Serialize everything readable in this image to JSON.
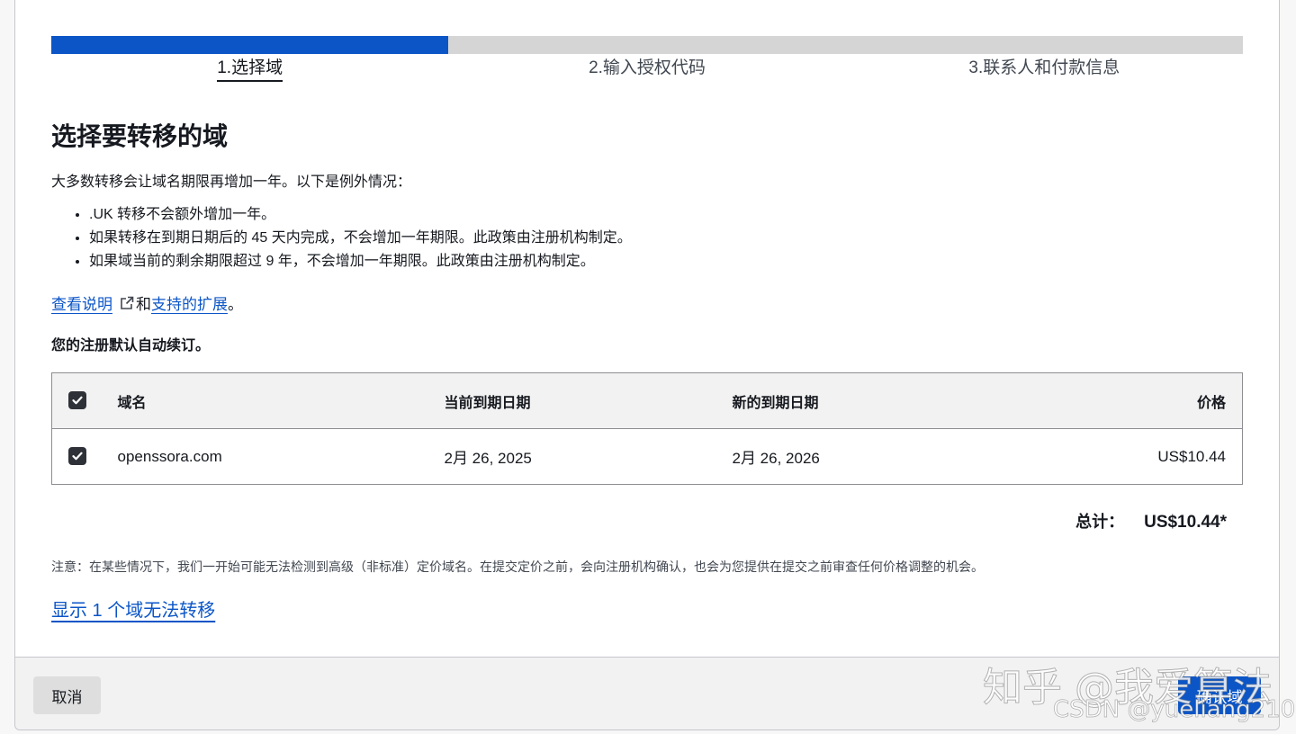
{
  "wizard": {
    "steps": [
      {
        "label": "1.选择域",
        "active": true
      },
      {
        "label": "2.输入授权代码",
        "active": false
      },
      {
        "label": "3.联系人和付款信息",
        "active": false
      }
    ],
    "progress": 0.333
  },
  "page": {
    "title": "选择要转移的域",
    "intro": "大多数转移会让域名期限再增加一年。以下是例外情况：",
    "rules": [
      ".UK 转移不会额外增加一年。",
      "如果转移在到期日期后的 45 天内完成，不会增加一年期限。此政策由注册机构制定。",
      "如果域当前的剩余期限超过 9 年，不会增加一年期限。此政策由注册机构制定。"
    ],
    "links": {
      "instructions": "查看说明",
      "and": "和",
      "supported": "支持的扩展",
      "period": "。"
    },
    "auto_renew": "您的注册默认自动续订。"
  },
  "table": {
    "headers": {
      "domain": "域名",
      "current_expiry": "当前到期日期",
      "new_expiry": "新的到期日期",
      "price": "价格"
    },
    "rows": [
      {
        "checked": true,
        "domain": "openssora.com",
        "current_expiry": "2月 26, 2025",
        "new_expiry": "2月 26, 2026",
        "price": "US$10.44"
      }
    ]
  },
  "total": {
    "label": "总计：",
    "value": "US$10.44*"
  },
  "note": "注意：在某些情况下，我们一开始可能无法检测到高级（非标准）定价域名。在提交定价之前，会向注册机构确认，也会为您提供在提交之前审查任何价格调整的机会。",
  "show_unavailable": "显示 1 个域无法转移",
  "footer": {
    "cancel": "取消",
    "confirm": "确认域"
  },
  "watermarks": {
    "zhihu": "知乎 @我爱算法",
    "csdn": "CSDN @yueliang2100"
  },
  "colors": {
    "accent": "#0b55c7",
    "progress_track": "#d5d5d5",
    "text": "#16191f"
  }
}
